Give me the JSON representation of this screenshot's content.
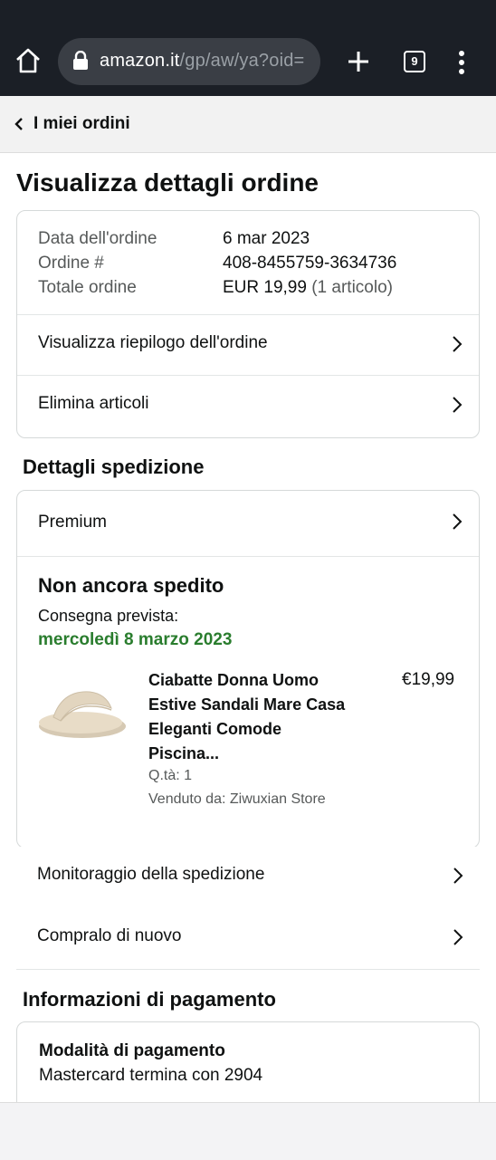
{
  "browser": {
    "url_domain": "amazon.it",
    "url_path": "/gp/aw/ya?oid=",
    "tab_count": "9"
  },
  "back_bar": {
    "label": "I miei ordini"
  },
  "page_title": "Visualizza dettagli ordine",
  "order_summary": {
    "date_label": "Data dell'ordine",
    "date_value": "6 mar 2023",
    "number_label": "Ordine #",
    "number_value": "408-8455759-3634736",
    "total_label": "Totale ordine",
    "total_value": "EUR 19,99",
    "total_items": "(1 articolo)",
    "links": [
      {
        "label": "Visualizza riepilogo dell'ordine"
      },
      {
        "label": "Elimina articoli"
      }
    ]
  },
  "shipping": {
    "section_title": "Dettagli spedizione",
    "method": "Premium",
    "status": "Non ancora spedito",
    "delivery_label": "Consegna prevista:",
    "delivery_date": "mercoledì 8 marzo 2023",
    "product": {
      "title": "Ciabatte Donna Uomo Estive Sandali Mare Casa Eleganti Comode Piscina...",
      "price": "€19,99",
      "qty": "Q.tà: 1",
      "seller": "Venduto da: Ziwuxian Store"
    },
    "links": [
      {
        "label": "Monitoraggio della spedizione"
      },
      {
        "label": "Compralo di nuovo"
      }
    ]
  },
  "payment": {
    "section_title": "Informazioni di pagamento",
    "method_label": "Modalità di pagamento",
    "method_value": "Mastercard termina con 2904"
  },
  "colors": {
    "chrome_bg": "#1b1f26",
    "delivery_green": "#2a7d2e"
  },
  "icons": [
    "home-icon",
    "lock-icon",
    "plus-icon",
    "tabs-icon",
    "more-icon",
    "chevron-left-icon",
    "chevron-right-icon"
  ]
}
